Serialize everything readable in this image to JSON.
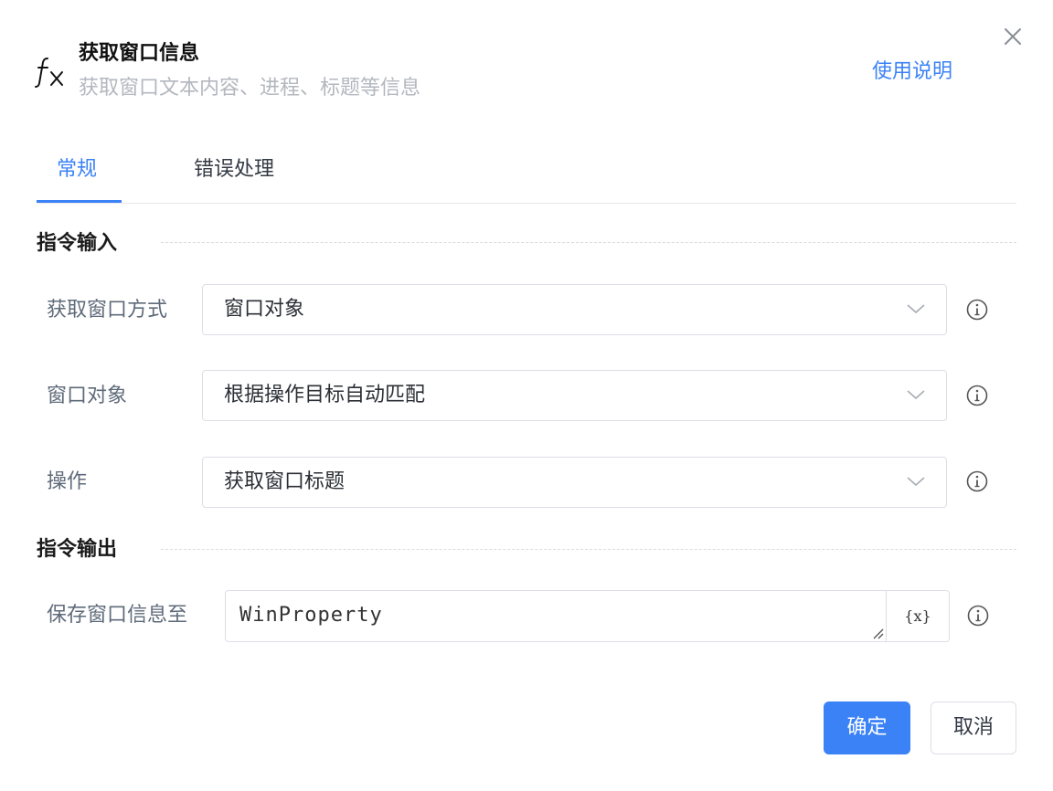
{
  "header": {
    "icon": "function-fx-icon",
    "title": "获取窗口信息",
    "subtitle": "获取窗口文本内容、进程、标题等信息",
    "help_link": "使用说明",
    "close_icon": "close-icon"
  },
  "tabs": [
    {
      "label": "常规",
      "active": true
    },
    {
      "label": "错误处理",
      "active": false
    }
  ],
  "input_section": {
    "title": "指令输入",
    "fields": [
      {
        "label": "获取窗口方式",
        "value": "窗口对象"
      },
      {
        "label": "窗口对象",
        "value": "根据操作目标自动匹配"
      },
      {
        "label": "操作",
        "value": "获取窗口标题"
      }
    ]
  },
  "output_section": {
    "title": "指令输出",
    "fields": [
      {
        "label": "保存窗口信息至",
        "value": "WinProperty",
        "variable_button": "{x}"
      }
    ]
  },
  "footer": {
    "confirm_label": "确定",
    "cancel_label": "取消"
  },
  "colors": {
    "accent": "#3b82f6",
    "muted_text": "#b3b7bf",
    "label_text": "#5f6b7a",
    "border": "#dcdfe6"
  }
}
